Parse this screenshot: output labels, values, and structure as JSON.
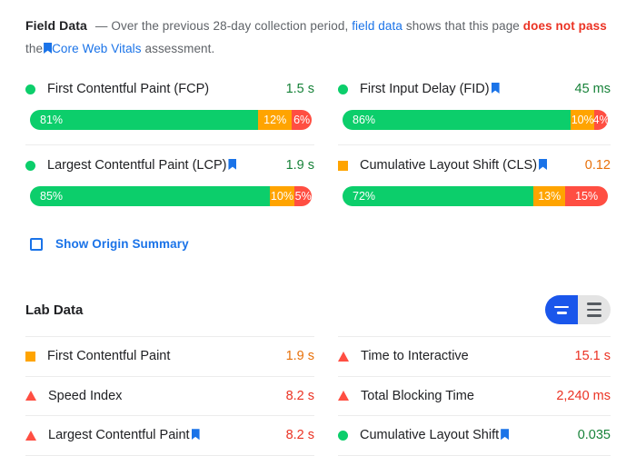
{
  "field_data": {
    "title": "Field Data",
    "dash": "—",
    "desc_1": "Over the previous 28-day collection period,",
    "link_field_data": "field data",
    "desc_2": "shows that this page",
    "fail_text": "does not pass",
    "desc_3": "the",
    "link_cwv": "Core Web Vitals",
    "desc_4": "assessment.",
    "metrics": [
      {
        "name": "First Contentful Paint (FCP)",
        "value": "1.5 s",
        "status": "good",
        "indicator": "circle",
        "has_flag": false,
        "distribution": [
          {
            "label": "81%",
            "pct": 81,
            "bucket": "good"
          },
          {
            "label": "12%",
            "pct": 12,
            "bucket": "average"
          },
          {
            "label": "6%",
            "pct": 7,
            "bucket": "poor"
          }
        ]
      },
      {
        "name": "First Input Delay (FID)",
        "value": "45 ms",
        "status": "good",
        "indicator": "circle",
        "has_flag": true,
        "distribution": [
          {
            "label": "86%",
            "pct": 86,
            "bucket": "good"
          },
          {
            "label": "10%",
            "pct": 9,
            "bucket": "average"
          },
          {
            "label": "4%",
            "pct": 5,
            "bucket": "poor"
          }
        ]
      },
      {
        "name": "Largest Contentful Paint (LCP)",
        "value": "1.9 s",
        "status": "good",
        "indicator": "circle",
        "has_flag": true,
        "distribution": [
          {
            "label": "85%",
            "pct": 85,
            "bucket": "good"
          },
          {
            "label": "10%",
            "pct": 9,
            "bucket": "average"
          },
          {
            "label": "5%",
            "pct": 6,
            "bucket": "poor"
          }
        ]
      },
      {
        "name": "Cumulative Layout Shift (CLS)",
        "value": "0.12",
        "status": "average",
        "indicator": "square",
        "has_flag": true,
        "distribution": [
          {
            "label": "72%",
            "pct": 72,
            "bucket": "good"
          },
          {
            "label": "13%",
            "pct": 12,
            "bucket": "average"
          },
          {
            "label": "15%",
            "pct": 16,
            "bucket": "poor"
          }
        ]
      }
    ],
    "origin_summary_label": "Show Origin Summary",
    "origin_summary_checked": false
  },
  "lab_data": {
    "title": "Lab Data",
    "view_toggle": {
      "condensed_label": "condensed-view",
      "expanded_label": "expanded-view",
      "selected": "condensed"
    },
    "metrics": [
      {
        "name": "First Contentful Paint",
        "value": "1.9 s",
        "status": "average",
        "indicator": "square",
        "has_flag": false
      },
      {
        "name": "Time to Interactive",
        "value": "15.1 s",
        "status": "poor",
        "indicator": "triangle",
        "has_flag": false
      },
      {
        "name": "Speed Index",
        "value": "8.2 s",
        "status": "poor",
        "indicator": "triangle",
        "has_flag": false
      },
      {
        "name": "Total Blocking Time",
        "value": "2,240 ms",
        "status": "poor",
        "indicator": "triangle",
        "has_flag": false
      },
      {
        "name": "Largest Contentful Paint",
        "value": "8.2 s",
        "status": "poor",
        "indicator": "triangle",
        "has_flag": true
      },
      {
        "name": "Cumulative Layout Shift",
        "value": "0.035",
        "status": "good",
        "indicator": "circle",
        "has_flag": true
      }
    ]
  },
  "colors": {
    "good": "#0cce6b",
    "average": "#ffa400",
    "poor": "#ff4e42",
    "good_text": "#178239",
    "average_text": "#e8710a",
    "poor_text": "#eb3223",
    "link": "#1a73e8",
    "toggle_active": "#1a56eb"
  }
}
